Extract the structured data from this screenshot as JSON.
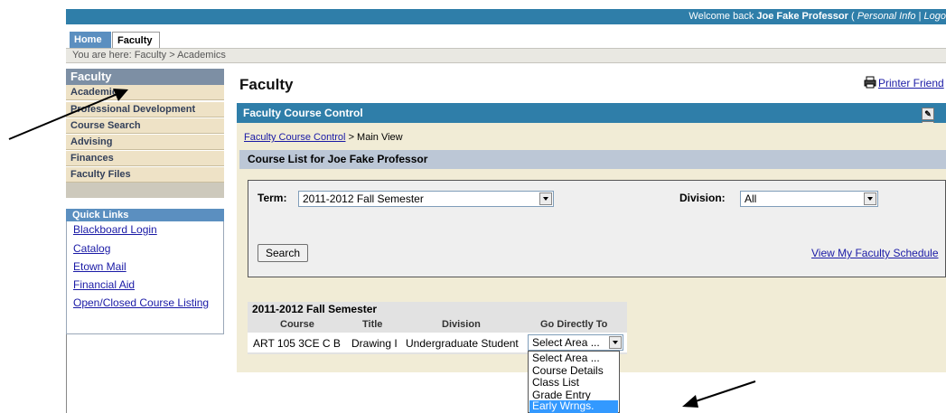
{
  "header": {
    "welcome_prefix": "Welcome back",
    "user_name": "Joe Fake Professor",
    "paren_open": "(",
    "personal_info": "Personal Info",
    "separator": "|",
    "logout": "Logo"
  },
  "tabs": [
    {
      "label": "Home"
    },
    {
      "label": "Faculty"
    }
  ],
  "breadcrumb": "You are here:  Faculty > Academics",
  "sidebar": {
    "title": "Faculty",
    "items": [
      {
        "label": "Academics"
      },
      {
        "label": "Professional Development"
      },
      {
        "label": "Course Search"
      },
      {
        "label": "Advising"
      },
      {
        "label": "Finances"
      },
      {
        "label": "Faculty Files"
      }
    ]
  },
  "quick_links": {
    "title": "Quick Links",
    "items": [
      {
        "label": "Blackboard Login"
      },
      {
        "label": "Catalog"
      },
      {
        "label": "Etown Mail"
      },
      {
        "label": "Financial Aid"
      },
      {
        "label": "Open/Closed Course Listing"
      }
    ]
  },
  "main": {
    "title": "Faculty",
    "printer_label": "Printer Friend",
    "section_title": "Faculty Course Control",
    "help_label": "?",
    "nav_link": "Faculty Course Control",
    "nav_suffix": "> Main View",
    "course_list_title": "Course List for Joe Fake Professor",
    "term_label": "Term:",
    "term_value": "2011-2012 Fall Semester",
    "division_label": "Division:",
    "division_value": "All",
    "search_label": "Search",
    "schedule_link": "View My Faculty Schedule"
  },
  "table": {
    "title": "2011-2012 Fall Semester",
    "columns": [
      "Course",
      "Title",
      "Division",
      "Go Directly To"
    ],
    "rows": [
      {
        "course": "ART 105 3CE C B",
        "title": "Drawing I",
        "division": "Undergraduate Student",
        "select_value": "Select Area ..."
      }
    ],
    "dropdown_options": [
      "Select Area ...",
      "Course Details",
      "Class List",
      "Grade Entry",
      "Early Wrngs."
    ],
    "dropdown_selected": "Early Wrngs."
  },
  "colors": {
    "header_blue": "#2f7ea9",
    "nav_tan": "#eee2c6",
    "panel_bg": "#f1ecd6",
    "highlight": "#3399ff"
  }
}
